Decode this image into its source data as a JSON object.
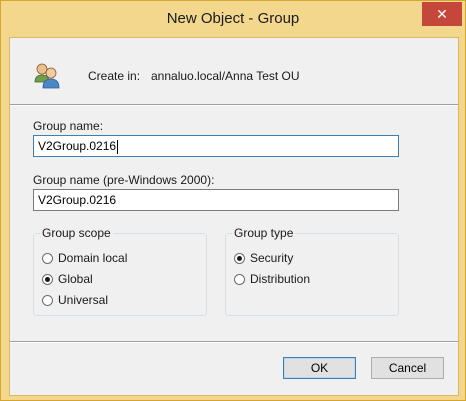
{
  "window": {
    "title": "New Object - Group",
    "close_glyph": "✕"
  },
  "header": {
    "icon": "group-icon",
    "create_in_label": "Create in:",
    "create_in_value": "annaluo.local/Anna Test OU"
  },
  "form": {
    "group_name_label": "Group name:",
    "group_name_value": "V2Group.0216",
    "pre2000_label": "Group name (pre-Windows 2000):",
    "pre2000_value": "V2Group.0216"
  },
  "group_scope": {
    "title": "Group scope",
    "options": [
      "Domain local",
      "Global",
      "Universal"
    ],
    "selected": "Global"
  },
  "group_type": {
    "title": "Group type",
    "options": [
      "Security",
      "Distribution"
    ],
    "selected": "Security"
  },
  "buttons": {
    "ok": "OK",
    "cancel": "Cancel"
  },
  "colors": {
    "frame": "#f3d78d",
    "close": "#c5473b",
    "client": "#f0f0f0"
  }
}
